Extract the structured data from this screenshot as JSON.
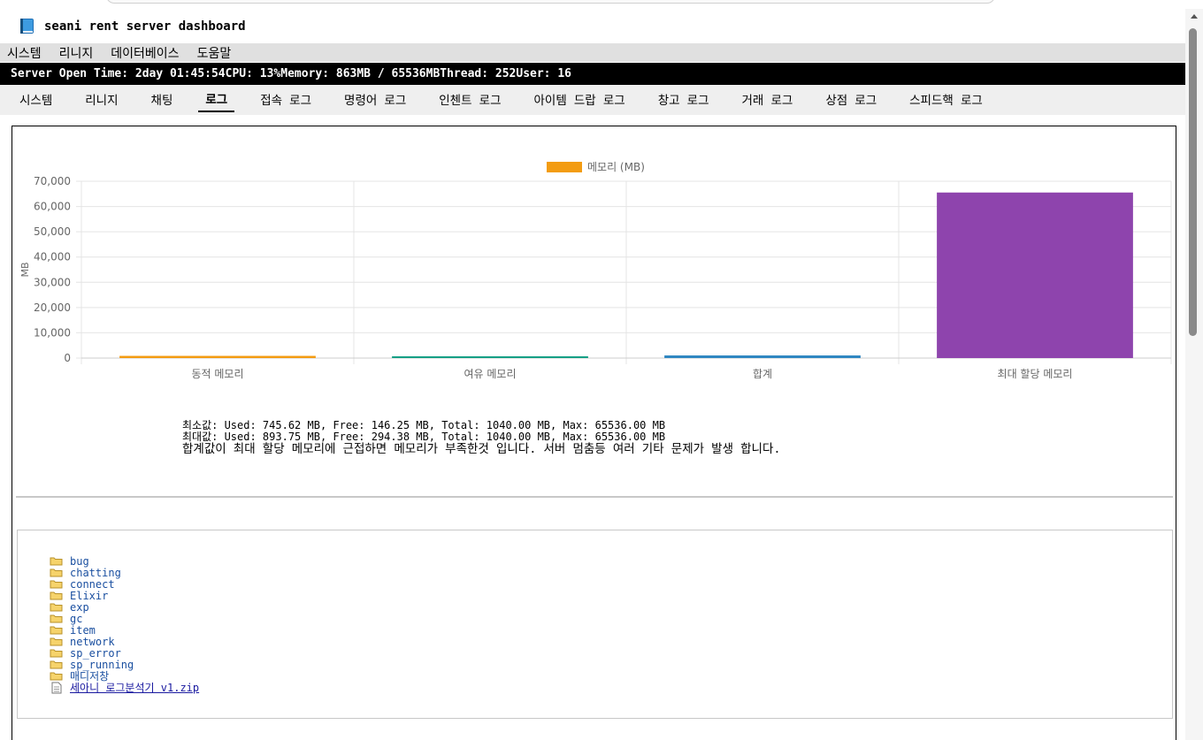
{
  "app": {
    "title": "seani rent server dashboard"
  },
  "menubar": {
    "items": [
      "시스템",
      "리니지",
      "데이터베이스",
      "도움말"
    ]
  },
  "status": {
    "server_open": "Server Open Time: 2day 01:45:54",
    "cpu": "CPU: 13%",
    "memory": "Memory: 863MB / 65536MB",
    "thread": "Thread: 252",
    "user": "User: 16"
  },
  "tabs": {
    "items": [
      "시스템",
      "리니지",
      "채팅",
      "로그",
      "접속 로그",
      "명령어 로그",
      "인첸트 로그",
      "아이템 드랍 로그",
      "창고 로그",
      "거래 로그",
      "상점 로그",
      "스피드핵 로그"
    ],
    "active": "로그"
  },
  "chart_data": {
    "type": "bar",
    "categories": [
      "동적 메모리",
      "여유 메모리",
      "합계",
      "최대 할당 메모리"
    ],
    "series": [
      {
        "name": "메모리 (MB)",
        "values": [
          863,
          177,
          1040,
          65536
        ]
      }
    ],
    "bar_colors": [
      "#f39c12",
      "#16a085",
      "#2e86c1",
      "#8e44ad"
    ],
    "legend_color": "#f39c12",
    "ylabel": "MB",
    "ylim": [
      0,
      70000
    ],
    "yticks": [
      "0",
      "10,000",
      "20,000",
      "30,000",
      "40,000",
      "50,000",
      "60,000",
      "70,000"
    ],
    "grid": true,
    "legend_position": "top"
  },
  "stats": {
    "min": "최소값: Used: 745.62 MB, Free: 146.25 MB, Total: 1040.00 MB, Max: 65536.00 MB",
    "max": "최대값: Used: 893.75 MB, Free: 294.38 MB, Total: 1040.00 MB, Max: 65536.00 MB",
    "note": "합계값이 최대 할당 메모리에 근접하면 메모리가 부족한것 입니다. 서버 멈춤등 여러 기타 문제가 발생 합니다."
  },
  "files": {
    "folders": [
      "bug",
      "chatting",
      "connect",
      "Elixir",
      "exp",
      "gc",
      "item",
      "network",
      "sp_error",
      "sp_running",
      "매디저창"
    ],
    "zip": "세아니 로그분석기 v1.zip"
  },
  "icons": {
    "title": "book-icon",
    "folder": "folder-icon",
    "file": "file-icon"
  }
}
